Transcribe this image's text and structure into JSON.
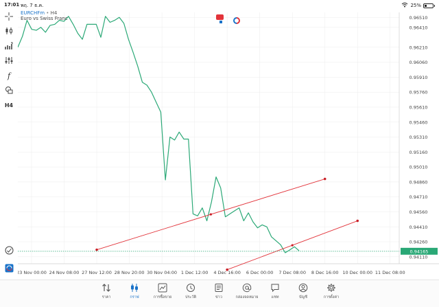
{
  "statusbar": {
    "time": "17:01",
    "date": "พฤ. 7 ธ.ค.",
    "battery_text": "25%",
    "battery_level": 0.25
  },
  "symbol": {
    "name": "EURCHFm",
    "separator": "•",
    "timeframe": "H4",
    "description": "Euro vs Swiss Franc"
  },
  "colors": {
    "line": "#2aa876",
    "trendline": "#e2333a",
    "accent": "#1a73c9",
    "grid": "#ececec",
    "sell": "#e2333a",
    "buy": "#1a73c9"
  },
  "tools": [
    {
      "name": "crosshair-icon"
    },
    {
      "name": "chart-type-icon"
    },
    {
      "name": "indicators-icon"
    },
    {
      "name": "settings-sliders-icon"
    },
    {
      "name": "function-icon",
      "glyph": "f"
    },
    {
      "name": "objects-icon"
    },
    {
      "name": "timeframe-label",
      "text": "H4"
    }
  ],
  "chart_data": {
    "type": "line",
    "x_labels": [
      "23 Nov 00:00",
      "24 Nov 08:00",
      "27 Nov 12:00",
      "28 Nov 20:00",
      "30 Nov 04:00",
      "1 Dec 12:00",
      "4 Dec 16:00",
      "6 Dec 00:00",
      "7 Dec 08:00",
      "8 Dec 16:00",
      "10 Dec 00:00",
      "11 Dec 08:00"
    ],
    "y_ticks": [
      "0.96510",
      "0.96410",
      "0.96210",
      "0.96060",
      "0.95910",
      "0.95760",
      "0.95610",
      "0.95460",
      "0.95310",
      "0.95160",
      "0.95010",
      "0.94860",
      "0.94710",
      "0.94560",
      "0.94410",
      "0.94260",
      "0.94110"
    ],
    "ylim": [
      0.9404,
      0.9656
    ],
    "current_price": "0.94165",
    "values": [
      0.9621,
      0.9632,
      0.9648,
      0.9639,
      0.9638,
      0.9641,
      0.9636,
      0.9643,
      0.9644,
      0.9648,
      0.9647,
      0.9652,
      0.9644,
      0.9635,
      0.9629,
      0.9644,
      0.9644,
      0.9644,
      0.9631,
      0.9652,
      0.9646,
      0.9648,
      0.9651,
      0.9645,
      0.9629,
      0.9616,
      0.9602,
      0.9586,
      0.9583,
      0.9576,
      0.9566,
      0.9556,
      0.9488,
      0.9531,
      0.9528,
      0.9536,
      0.9529,
      0.9529,
      0.9454,
      0.9452,
      0.946,
      0.9447,
      0.9466,
      0.9491,
      0.948,
      0.9451,
      0.9454,
      0.9457,
      0.946,
      0.9447,
      0.9455,
      0.9446,
      0.944,
      0.9443,
      0.9441,
      0.9431,
      0.9427,
      0.9423,
      0.9415,
      0.9418,
      0.9421,
      0.9417
    ],
    "trendlines": [
      {
        "from": [
          "27 Nov 12:00",
          0.9418
        ],
        "to": [
          "8 Dec 16:00",
          0.9489
        ]
      },
      {
        "from": [
          "4 Dec 16:00",
          0.9398
        ],
        "to": [
          "10 Dec 00:00",
          0.9447
        ]
      }
    ]
  },
  "trade_buttons": {
    "sell_icon": "sell-icon",
    "buy_icon": "buy-icon"
  },
  "tabs": [
    {
      "name": "tab-quotes",
      "label": "ราคา",
      "icon": "arrows-updown-icon"
    },
    {
      "name": "tab-chart",
      "label": "กราฟ",
      "icon": "candles-icon",
      "active": true
    },
    {
      "name": "tab-trade",
      "label": "การซื้อขาย",
      "icon": "trade-chart-icon"
    },
    {
      "name": "tab-history",
      "label": "ประวัติ",
      "icon": "clock-history-icon"
    },
    {
      "name": "tab-news",
      "label": "ข่าว",
      "icon": "newspaper-icon"
    },
    {
      "name": "tab-mailbox",
      "label": "กล่องจดหมาย",
      "icon": "at-icon"
    },
    {
      "name": "tab-chat",
      "label": "แชท",
      "icon": "chat-icon"
    },
    {
      "name": "tab-accounts",
      "label": "บัญชี",
      "icon": "user-icon"
    },
    {
      "name": "tab-settings",
      "label": "การตั้งค่า",
      "icon": "gear-icon"
    }
  ]
}
